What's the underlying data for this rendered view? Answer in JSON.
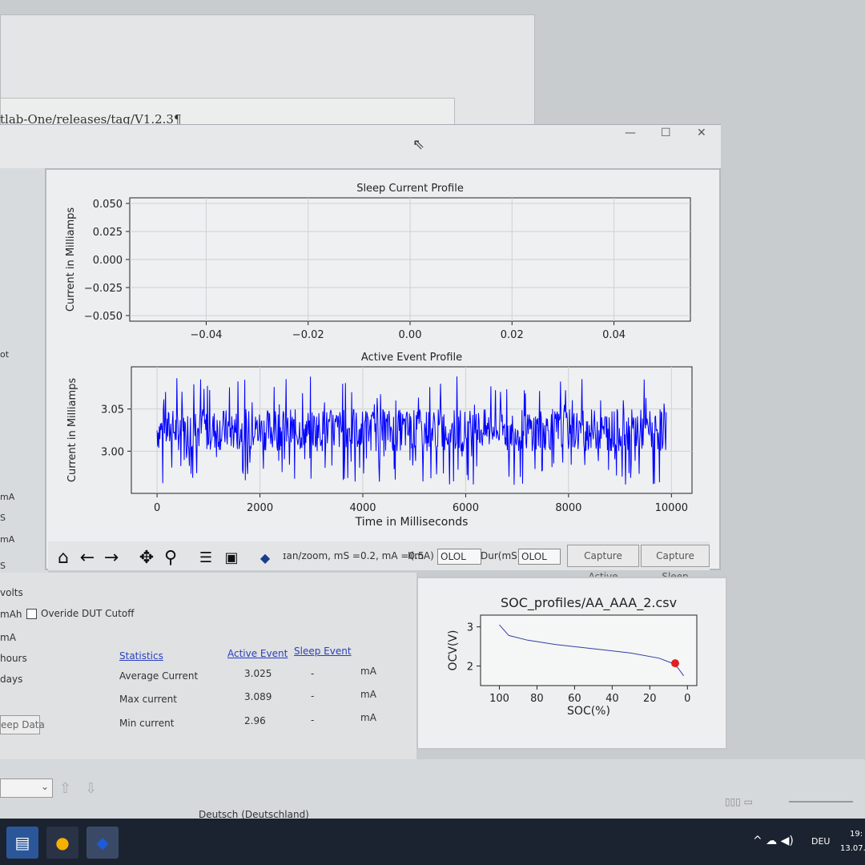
{
  "background_doc": {
    "url_fragment": "tlab-One/releases/tag/V1.2.3¶"
  },
  "left_panel": {
    "labels": [
      "ot",
      "mA",
      "S",
      "mA",
      "S",
      "volts",
      "mAh",
      "mA"
    ],
    "override_checkbox_label": "Overide DUT Cutoff",
    "hours_label": "hours",
    "days_label": "days",
    "sleep_data_button": "eep Data"
  },
  "window": {
    "minimize": "—",
    "maximize": "☐",
    "close": "✕"
  },
  "toolbar": {
    "status_text": "ɪan/zoom, mS =0.2, mA =0.5",
    "current_label": "I(mA)",
    "current_value": "OLOL",
    "duration_label": "Dur(mS)",
    "duration_value": "OLOL",
    "capture_active": "Capture Active",
    "capture_sleep": "Capture Sleep",
    "icons": [
      "home-icon",
      "back-arrow-icon",
      "forward-arrow-icon",
      "pan-icon",
      "zoom-icon",
      "configure-icon",
      "save-icon",
      "app-logo-icon"
    ]
  },
  "statistics": {
    "title": "Statistics",
    "col_active": "Active Event",
    "col_sleep": "Sleep Event",
    "rows": [
      {
        "label": "Average Current",
        "active": "3.025",
        "sleep": "-",
        "unit": "mA"
      },
      {
        "label": "Max current",
        "active": "3.089",
        "sleep": "-",
        "unit": "mA"
      },
      {
        "label": "Min current",
        "active": "2.96",
        "sleep": "-",
        "unit": "mA"
      }
    ]
  },
  "status_bar": {
    "language": "Deutsch (Deutschland)"
  },
  "taskbar": {
    "lang": "DEU",
    "time": "19:",
    "date": "13.07."
  },
  "chart_data": [
    {
      "type": "line",
      "title": "Sleep Current Profile",
      "ylabel": "Current in Milliamps",
      "xlabel": "",
      "xlim": [
        -0.055,
        0.055
      ],
      "ylim": [
        -0.055,
        0.055
      ],
      "xticks": [
        "−0.04",
        "−0.02",
        "0.00",
        "0.02",
        "0.04"
      ],
      "yticks": [
        "0.050",
        "0.025",
        "0.000",
        "−0.025",
        "−0.050"
      ],
      "series": [],
      "grid": true
    },
    {
      "type": "line",
      "title": "Active Event Profile",
      "ylabel": "Current in Milliamps",
      "xlabel": "Time in Milliseconds",
      "xlim": [
        -500,
        10400
      ],
      "ylim": [
        2.95,
        3.1
      ],
      "xticks": [
        "0",
        "2000",
        "4000",
        "6000",
        "8000",
        "10000"
      ],
      "yticks": [
        "3.05",
        "3.00"
      ],
      "series": [
        {
          "color": "#0000ff",
          "x_range": [
            0,
            9900
          ],
          "mean": 3.025,
          "min": 2.96,
          "max": 3.089
        }
      ],
      "grid": true
    },
    {
      "type": "line",
      "title": "SOC_profiles/AA_AAA_2.csv",
      "ylabel": "OCV(V)",
      "xlabel": "SOC(%)",
      "xlim": [
        110,
        -5
      ],
      "ylim": [
        1.5,
        3.3
      ],
      "xticks": [
        "100",
        "80",
        "60",
        "40",
        "20",
        "0"
      ],
      "yticks": [
        "3",
        "2"
      ],
      "x": [
        100,
        95,
        85,
        70,
        50,
        30,
        15,
        8,
        5,
        2
      ],
      "y": [
        3.05,
        2.78,
        2.66,
        2.55,
        2.44,
        2.33,
        2.2,
        2.07,
        1.95,
        1.75
      ],
      "marker": {
        "x": 6.5,
        "y": 2.07,
        "color": "#e02020"
      },
      "line_color": "#3040a0"
    }
  ]
}
